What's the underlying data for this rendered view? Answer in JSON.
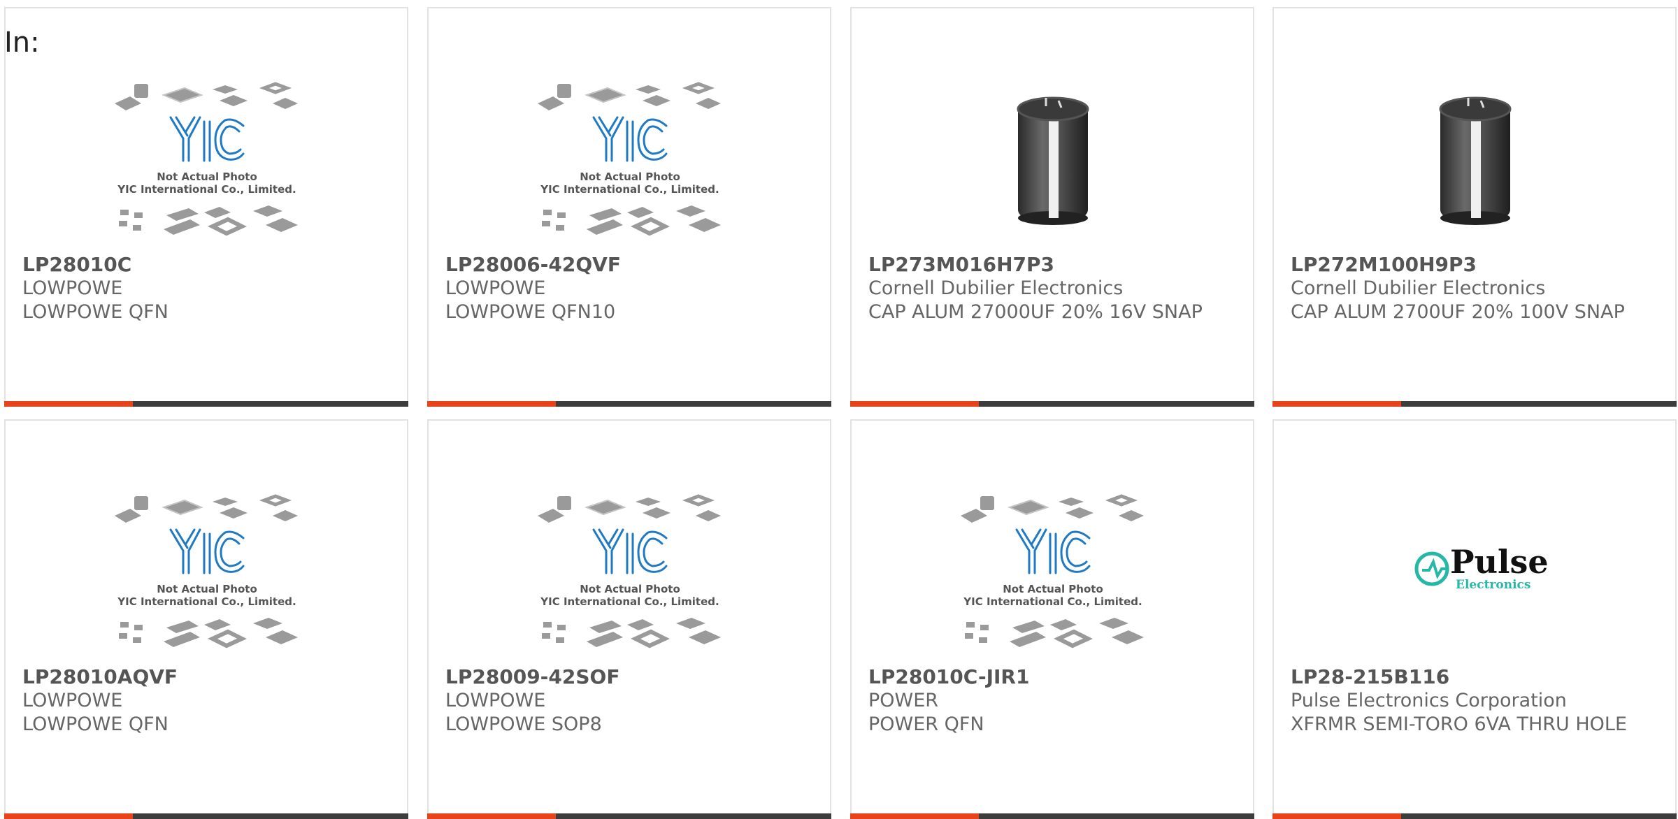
{
  "page": {
    "heading": "In:"
  },
  "colors": {
    "accent": "#e8431b",
    "bar": "#3d3d3d",
    "yic_blue": "#1f7ac4",
    "pulse_teal": "#25b8a6"
  },
  "cards": [
    {
      "part": "LP28010C",
      "manufacturer": "LOWPOWE",
      "description": "LOWPOWE QFN",
      "image": "yic-placeholder-icon",
      "caption1": "Not Actual Photo",
      "caption2": "YIC International Co., Limited.",
      "logo_text": "YIC"
    },
    {
      "part": "LP28006-42QVF",
      "manufacturer": "LOWPOWE",
      "description": "LOWPOWE QFN10",
      "image": "yic-placeholder-icon",
      "caption1": "Not Actual Photo",
      "caption2": "YIC International Co., Limited.",
      "logo_text": "YIC"
    },
    {
      "part": "LP273M016H7P3",
      "manufacturer": "Cornell Dubilier Electronics",
      "description": "CAP ALUM 27000UF 20% 16V SNAP",
      "image": "capacitor-icon"
    },
    {
      "part": "LP272M100H9P3",
      "manufacturer": "Cornell Dubilier Electronics",
      "description": "CAP ALUM 2700UF 20% 100V SNAP",
      "image": "capacitor-icon"
    },
    {
      "part": "LP28010AQVF",
      "manufacturer": "LOWPOWE",
      "description": "LOWPOWE QFN",
      "image": "yic-placeholder-icon",
      "caption1": "Not Actual Photo",
      "caption2": "YIC International Co., Limited.",
      "logo_text": "YIC"
    },
    {
      "part": "LP28009-42SOF",
      "manufacturer": "LOWPOWE",
      "description": "LOWPOWE SOP8",
      "image": "yic-placeholder-icon",
      "caption1": "Not Actual Photo",
      "caption2": "YIC International Co., Limited.",
      "logo_text": "YIC"
    },
    {
      "part": "LP28010C-JIR1",
      "manufacturer": "POWER",
      "description": "POWER QFN",
      "image": "yic-placeholder-icon",
      "caption1": "Not Actual Photo",
      "caption2": "YIC International Co., Limited.",
      "logo_text": "YIC"
    },
    {
      "part": "LP28-215B116",
      "manufacturer": "Pulse Electronics Corporation",
      "description": "XFRMR SEMI-TORO 6VA THRU HOLE",
      "image": "pulse-logo-icon",
      "logo_word": "Pulse",
      "logo_sub": "Electronics"
    }
  ]
}
